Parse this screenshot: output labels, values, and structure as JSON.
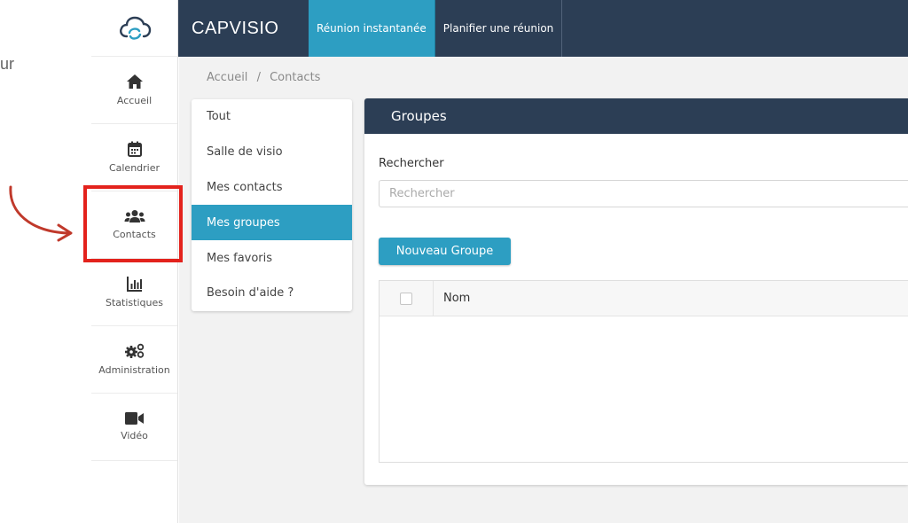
{
  "annotation": {
    "partial_text": "ur"
  },
  "sidebar": {
    "items": [
      {
        "label": "Accueil",
        "icon": "home-icon"
      },
      {
        "label": "Calendrier",
        "icon": "calendar-icon"
      },
      {
        "label": "Contacts",
        "icon": "users-icon"
      },
      {
        "label": "Statistiques",
        "icon": "chart-icon"
      },
      {
        "label": "Administration",
        "icon": "gears-icon"
      },
      {
        "label": "Vidéo",
        "icon": "video-icon"
      }
    ]
  },
  "topbar": {
    "brand": "CAPVISIO",
    "tabs": [
      {
        "label": "Réunion instantanée",
        "active": true
      },
      {
        "label": "Planifier une réunion",
        "active": false
      }
    ]
  },
  "breadcrumb": {
    "home": "Accueil",
    "separator": "/",
    "current": "Contacts"
  },
  "filters": [
    {
      "label": "Tout"
    },
    {
      "label": "Salle de visio"
    },
    {
      "label": "Mes contacts"
    },
    {
      "label": "Mes groupes",
      "active": true
    },
    {
      "label": "Mes favoris"
    },
    {
      "label": "Besoin d'aide ?"
    }
  ],
  "groups": {
    "title": "Groupes",
    "search_label": "Rechercher",
    "search_placeholder": "Rechercher",
    "search_value": "",
    "new_button": "Nouveau Groupe",
    "table": {
      "columns": [
        "Nom"
      ]
    }
  },
  "colors": {
    "navy": "#2c3e55",
    "accent": "#2d9ec2",
    "highlight": "#e3221c",
    "arrow": "#c0392b"
  }
}
